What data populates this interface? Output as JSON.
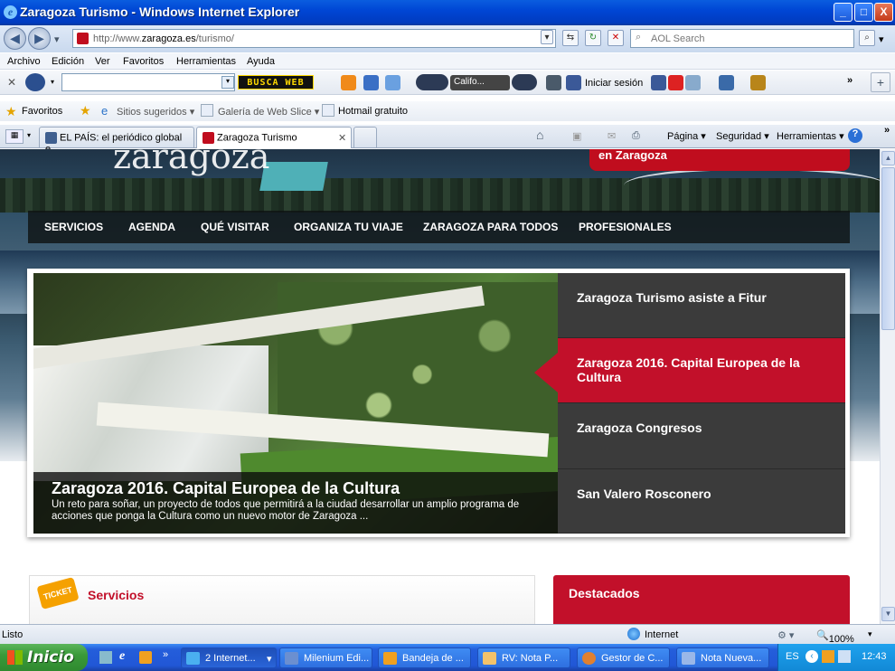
{
  "window": {
    "title": "Zaragoza Turismo - Windows Internet Explorer",
    "controls": [
      "_",
      "□",
      "X"
    ]
  },
  "address": {
    "url_prefix": "http://www.",
    "url_domain": "zaragoza.es",
    "url_path": "/turismo/",
    "search_placeholder": "AOL Search"
  },
  "menu": [
    "Archivo",
    "Edición",
    "Ver",
    "Favoritos",
    "Herramientas",
    "Ayuda"
  ],
  "toolbar": {
    "busca_label": "BUSCA WEB",
    "calif_label": "Califo...",
    "login_label": "Iniciar sesión",
    "more": "»"
  },
  "favorites": {
    "label": "Favoritos",
    "items": [
      "Sitios sugeridos ▾",
      "Galería de Web Slice ▾",
      "Hotmail gratuito"
    ]
  },
  "tabs": [
    {
      "label": "EL PAÍS: el periódico global e...",
      "active": false
    },
    {
      "label": "Zaragoza Turismo",
      "active": true
    }
  ],
  "commands": {
    "pagina": "Página ▾",
    "seguridad": "Seguridad ▾",
    "herramientas": "Herramientas ▾"
  },
  "site": {
    "logo_text": "zaragoza",
    "banner_text": "en Zaragoza",
    "nav": [
      "SERVICIOS",
      "AGENDA",
      "QUÉ VISITAR",
      "ORGANIZA TU VIAJE",
      "ZARAGOZA PARA TODOS",
      "PROFESIONALES"
    ],
    "slider": {
      "caption_title": "Zaragoza 2016. Capital Europea de la Cultura",
      "caption_text": "Un reto para soñar, un proyecto de todos que permitirá a la ciudad desarrollar un amplio programa de acciones que ponga la Cultura como un nuevo motor de Zaragoza ...",
      "items": [
        "Zaragoza Turismo asiste a Fitur",
        "Zaragoza 2016. Capital Europea de la Cultura",
        "Zaragoza Congresos",
        "San Valero Rosconero"
      ],
      "active_index": 1
    },
    "servicios_title": "Servicios",
    "destacados_title": "Destacados",
    "ticket_label": "TICKET"
  },
  "status": {
    "text": "Listo",
    "zone": "Internet",
    "zoom": "100%"
  },
  "taskbar": {
    "start_label": "Inicio",
    "tasks": [
      "2 Internet...",
      "Milenium Edi...",
      "Bandeja de ...",
      "RV: Nota P...",
      "Gestor de C...",
      "Nota Nueva..."
    ],
    "lang": "ES",
    "time": "12:43"
  },
  "colors": {
    "accent_red": "#c2102a",
    "nav_bg": "#141414",
    "taskbar_blue": "#245edb"
  }
}
